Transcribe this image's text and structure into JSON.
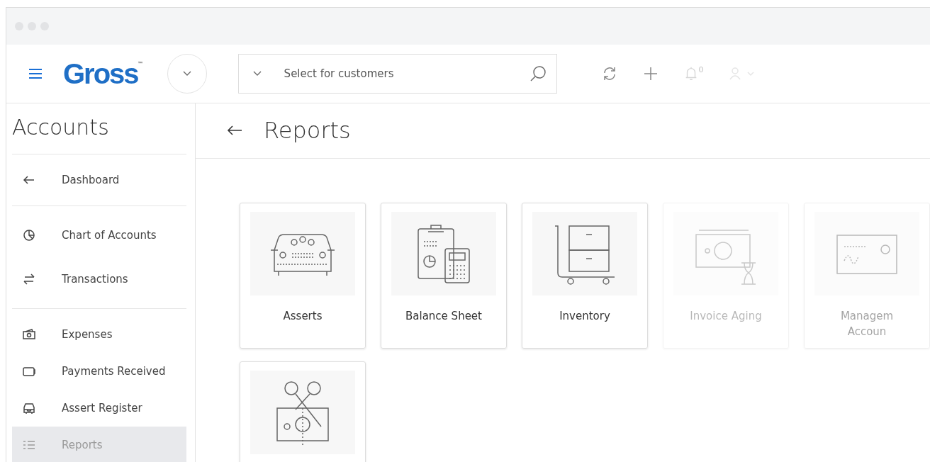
{
  "header": {
    "logo": "Gross",
    "logo_mark": "™",
    "search": {
      "placeholder": "Select for customers"
    },
    "notifications": "0"
  },
  "sidebar": {
    "title": "Accounts",
    "groups": [
      [
        {
          "label": "Dashboard",
          "kind": "back",
          "selected": false
        }
      ],
      [
        {
          "label": "Chart of Accounts",
          "kind": "pie",
          "selected": false
        },
        {
          "label": "Transactions",
          "kind": "swap",
          "selected": false
        }
      ],
      [
        {
          "label": "Expenses",
          "kind": "cash",
          "selected": false
        },
        {
          "label": "Payments Received",
          "kind": "wallet",
          "selected": false
        },
        {
          "label": "Assert Register",
          "kind": "car",
          "selected": false
        },
        {
          "label": "Reports",
          "kind": "list",
          "selected": true
        }
      ]
    ]
  },
  "page": {
    "title": "Reports",
    "cards": [
      {
        "lines": [
          "Asserts"
        ],
        "kind": "car"
      },
      {
        "lines": [
          "Balance Sheet"
        ],
        "kind": "clipboard"
      },
      {
        "lines": [
          "Inventory"
        ],
        "kind": "cart"
      },
      {
        "lines": [
          "Invoice Aging"
        ],
        "kind": "money-time"
      },
      {
        "lines": [
          "Managem",
          "Accoun"
        ],
        "kind": "cheque"
      },
      {
        "kind": "scissors"
      }
    ]
  }
}
